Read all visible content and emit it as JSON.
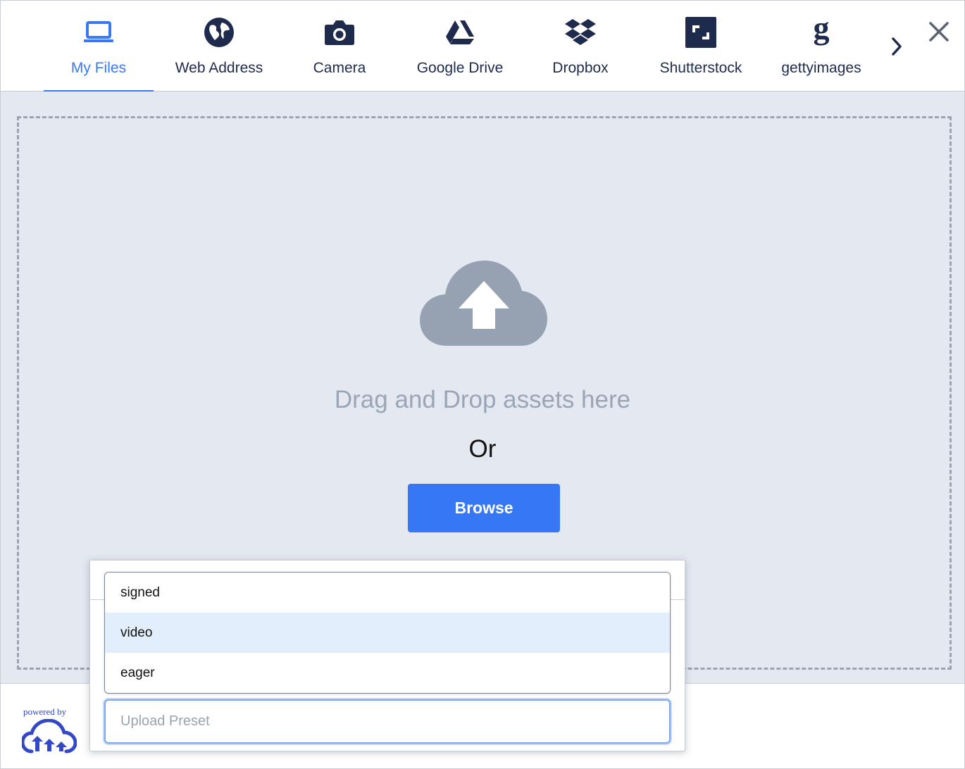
{
  "tabs": [
    {
      "label": "My Files",
      "icon": "laptop-icon",
      "active": true
    },
    {
      "label": "Web Address",
      "icon": "globe-icon",
      "active": false
    },
    {
      "label": "Camera",
      "icon": "camera-icon",
      "active": false
    },
    {
      "label": "Google Drive",
      "icon": "google-drive-icon",
      "active": false
    },
    {
      "label": "Dropbox",
      "icon": "dropbox-icon",
      "active": false
    },
    {
      "label": "Shutterstock",
      "icon": "shutterstock-icon",
      "active": false
    },
    {
      "label": "gettyimages",
      "icon": "gettyimages-icon",
      "active": false
    }
  ],
  "main": {
    "drag_text": "Drag and Drop assets here",
    "or_text": "Or",
    "browse_label": "Browse"
  },
  "footer": {
    "powered_by": "powered by"
  },
  "preset": {
    "options": [
      "signed",
      "video",
      "eager"
    ],
    "highlighted": "video",
    "input_value": "",
    "placeholder": "Upload Preset"
  },
  "colors": {
    "accent": "#3a78f2",
    "browse_button": "#3577f5",
    "icon_navy": "#1f2b4d",
    "drop_background": "#e4e9f1",
    "cloud_gray": "#96a1b1",
    "brand_blue": "#3448c5"
  }
}
